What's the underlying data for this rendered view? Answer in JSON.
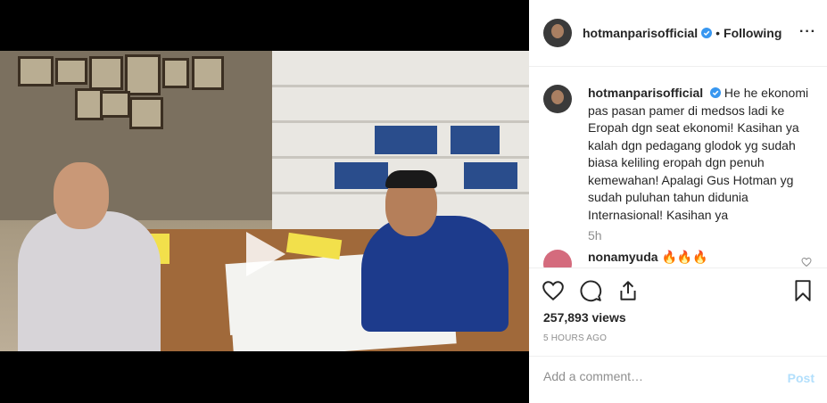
{
  "post": {
    "username": "hotmanparisofficial",
    "follow_status": "Following",
    "more_icon": "more-options-icon",
    "caption": "He he ekonomi pas pasan pamer di medsos ladi ke Eropah dgn seat ekonomi! Kasihan ya kalah dgn pedagang glodok yg sudah biasa keliling eropah dgn penuh kemewahan! Apalagi Gus Hotman yg sudah puluhan tahun didunia Internasional! Kasihan ya",
    "caption_time": "5h",
    "comment": {
      "username": "nonamyuda",
      "text": "🔥🔥🔥"
    },
    "views": "257,893 views",
    "timestamp": "5 HOURS AGO",
    "add_comment_placeholder": "Add a comment…",
    "post_label": "Post"
  },
  "colors": {
    "verified": "#3897f0",
    "muted": "#8e8e8e",
    "post_disabled": "#b2dffc"
  },
  "icons": [
    "play-icon",
    "verified-icon",
    "heart-icon",
    "comment-icon",
    "share-icon",
    "bookmark-icon"
  ]
}
